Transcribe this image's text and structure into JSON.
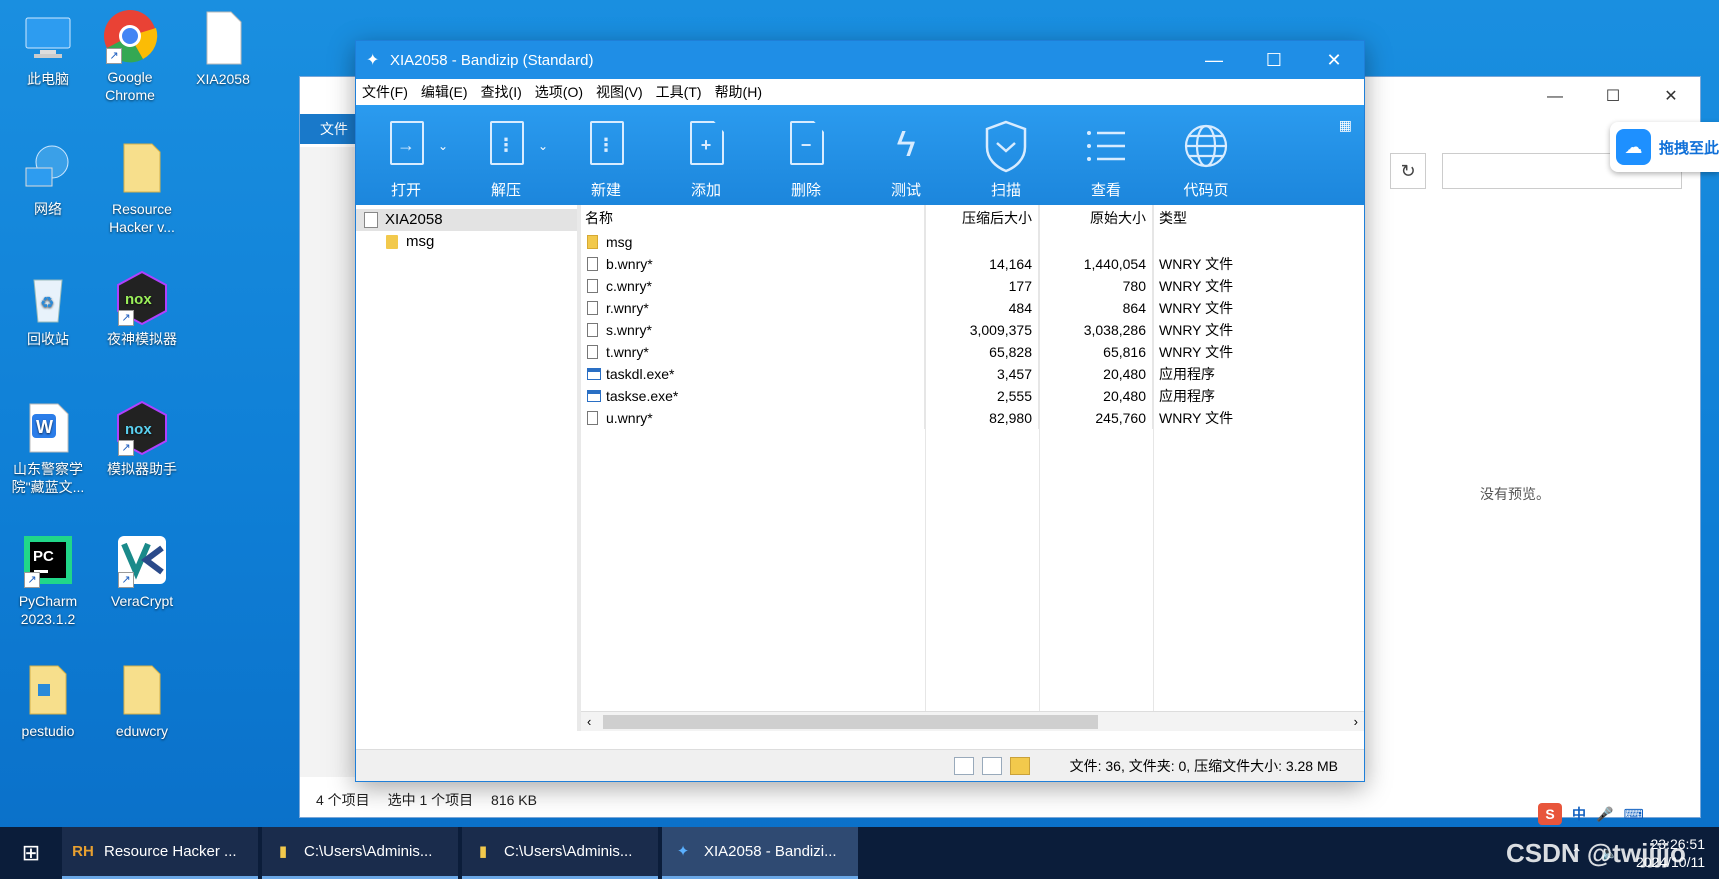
{
  "desktop": {
    "icons": [
      {
        "label": "此电脑",
        "icon": "computer-icon"
      },
      {
        "label": "Google Chrome",
        "icon": "chrome-icon"
      },
      {
        "label": "XIA2058",
        "icon": "file-icon"
      },
      {
        "label": "网络",
        "icon": "network-icon"
      },
      {
        "label": "Resource Hacker v...",
        "icon": "folder-icon"
      },
      {
        "label": "回收站",
        "icon": "recycle-bin-icon"
      },
      {
        "label": "夜神模拟器",
        "icon": "nox-icon"
      },
      {
        "label": "山东警察学院\"藏蓝文...",
        "icon": "wps-icon"
      },
      {
        "label": "模拟器助手",
        "icon": "nox-icon"
      },
      {
        "label": "PyCharm 2023.1.2",
        "icon": "pycharm-icon"
      },
      {
        "label": "VeraCrypt",
        "icon": "veracrypt-icon"
      },
      {
        "label": "pestudio",
        "icon": "folder-icon"
      },
      {
        "label": "eduwcry",
        "icon": "folder-icon"
      }
    ]
  },
  "explorer": {
    "file_tab": "文件",
    "no_preview": "没有预览。",
    "status_items": "4 个项目",
    "status_selected": "选中 1 个项目",
    "status_size": "816 KB"
  },
  "baidu": {
    "label": "拖拽至此"
  },
  "bandizip": {
    "title": "XIA2058 - Bandizip (Standard)",
    "menu": [
      "文件(F)",
      "编辑(E)",
      "查找(I)",
      "选项(O)",
      "视图(V)",
      "工具(T)",
      "帮助(H)"
    ],
    "toolbar": [
      {
        "label": "打开",
        "icon": "open-icon"
      },
      {
        "label": "解压",
        "icon": "extract-icon"
      },
      {
        "label": "新建",
        "icon": "new-archive-icon"
      },
      {
        "label": "添加",
        "icon": "add-icon"
      },
      {
        "label": "删除",
        "icon": "delete-icon"
      },
      {
        "label": "测试",
        "icon": "test-icon"
      },
      {
        "label": "扫描",
        "icon": "scan-icon"
      },
      {
        "label": "查看",
        "icon": "view-icon"
      },
      {
        "label": "代码页",
        "icon": "codepage-icon"
      }
    ],
    "tree": {
      "root": "XIA2058",
      "child": "msg"
    },
    "columns": {
      "name": "名称",
      "compressed": "压缩后大小",
      "original": "原始大小",
      "type": "类型"
    },
    "files": [
      {
        "name": "msg",
        "compressed": "",
        "original": "",
        "type": "",
        "kind": "folder"
      },
      {
        "name": "b.wnry*",
        "compressed": "14,164",
        "original": "1,440,054",
        "type": "WNRY 文件",
        "kind": "file"
      },
      {
        "name": "c.wnry*",
        "compressed": "177",
        "original": "780",
        "type": "WNRY 文件",
        "kind": "file"
      },
      {
        "name": "r.wnry*",
        "compressed": "484",
        "original": "864",
        "type": "WNRY 文件",
        "kind": "file"
      },
      {
        "name": "s.wnry*",
        "compressed": "3,009,375",
        "original": "3,038,286",
        "type": "WNRY 文件",
        "kind": "file"
      },
      {
        "name": "t.wnry*",
        "compressed": "65,828",
        "original": "65,816",
        "type": "WNRY 文件",
        "kind": "file"
      },
      {
        "name": "taskdl.exe*",
        "compressed": "3,457",
        "original": "20,480",
        "type": "应用程序",
        "kind": "exe"
      },
      {
        "name": "taskse.exe*",
        "compressed": "2,555",
        "original": "20,480",
        "type": "应用程序",
        "kind": "exe"
      },
      {
        "name": "u.wnry*",
        "compressed": "82,980",
        "original": "245,760",
        "type": "WNRY 文件",
        "kind": "file"
      }
    ],
    "status": "文件: 36, 文件夹: 0, 压缩文件大小: 3.28 MB"
  },
  "taskbar": {
    "items": [
      {
        "label": "Resource Hacker ...",
        "icon": "RH"
      },
      {
        "label": "C:\\Users\\Adminis...",
        "icon": "folder"
      },
      {
        "label": "C:\\Users\\Adminis...",
        "icon": "folder"
      },
      {
        "label": "XIA2058 - Bandizi...",
        "icon": "bandizip"
      }
    ],
    "time": "23:26:51",
    "date": "2024/10/11",
    "ime": "中"
  },
  "watermark": "CSDN @twjjjjo"
}
